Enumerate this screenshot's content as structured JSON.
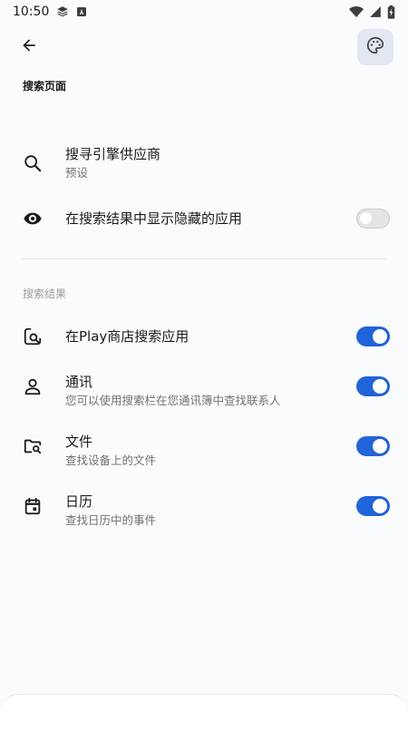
{
  "status_bar": {
    "time": "10:50"
  },
  "header": {
    "title": "搜索页面"
  },
  "settings": {
    "engine": {
      "title": "搜寻引擎供应商",
      "subtitle": "预设"
    },
    "hidden_apps": {
      "title": "在搜索结果中显示隐藏的应用",
      "enabled": false
    }
  },
  "results_section": {
    "label": "搜索结果",
    "items": [
      {
        "title": "在Play商店搜索应用",
        "subtitle": "",
        "icon": "store-search-icon",
        "enabled": true
      },
      {
        "title": "通讯",
        "subtitle": "您可以使用搜索栏在您通讯簿中查找联系人",
        "icon": "person-icon",
        "enabled": true
      },
      {
        "title": "文件",
        "subtitle": "查找设备上的文件",
        "icon": "folder-search-icon",
        "enabled": true
      },
      {
        "title": "日历",
        "subtitle": "查找日历中的事件",
        "icon": "calendar-icon",
        "enabled": true
      }
    ]
  },
  "colors": {
    "accent": "#2163d9",
    "background": "#fafbfd",
    "palette_button_bg": "#e2e7f1"
  }
}
